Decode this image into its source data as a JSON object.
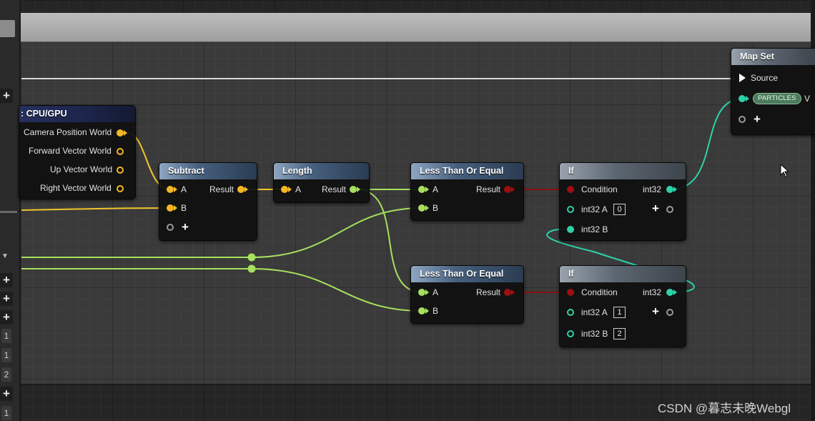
{
  "left_panel": {
    "buttons": [
      "+",
      "+",
      "+",
      "+",
      "+"
    ],
    "numbers": [
      "1",
      "1",
      "2",
      "1"
    ]
  },
  "nodes": {
    "cpu_gpu": {
      "title": "CPU/GPU",
      "outputs": [
        "Camera Position World",
        "Forward Vector World",
        "Up Vector World",
        "Right Vector World"
      ]
    },
    "subtract": {
      "title": "Subtract",
      "input_a": "A",
      "input_b": "B",
      "output": "Result"
    },
    "length": {
      "title": "Length",
      "input_a": "A",
      "output": "Result"
    },
    "less_equal_1": {
      "title": "Less Than Or Equal",
      "input_a": "A",
      "input_b": "B",
      "output": "Result"
    },
    "less_equal_2": {
      "title": "Less Than Or Equal",
      "input_a": "A",
      "input_b": "B",
      "output": "Result"
    },
    "if_1": {
      "title": "If",
      "condition": "Condition",
      "output": "int32",
      "int32_a": "int32 A",
      "int32_a_value": "0",
      "int32_b": "int32 B"
    },
    "if_2": {
      "title": "If",
      "condition": "Condition",
      "output": "int32",
      "int32_a": "int32 A",
      "int32_a_value": "1",
      "int32_b": "int32 B",
      "int32_b_value": "2"
    },
    "map_set": {
      "title": "Map Set",
      "source": "Source",
      "badge": "PARTICLES",
      "badge_suffix": "V"
    }
  },
  "colors": {
    "float_pin": "#f5b625",
    "bool_pin": "#9e0f0f",
    "int_pin": "#2ed1a8",
    "vec_pin": "#f0c52a",
    "green_wire": "#a6e05e"
  },
  "icons": {
    "add": "plus-icon",
    "cursor": "mouse-pointer-icon",
    "exec": "exec-arrow-icon"
  },
  "watermark": "CSDN @暮志未晚Webgl"
}
